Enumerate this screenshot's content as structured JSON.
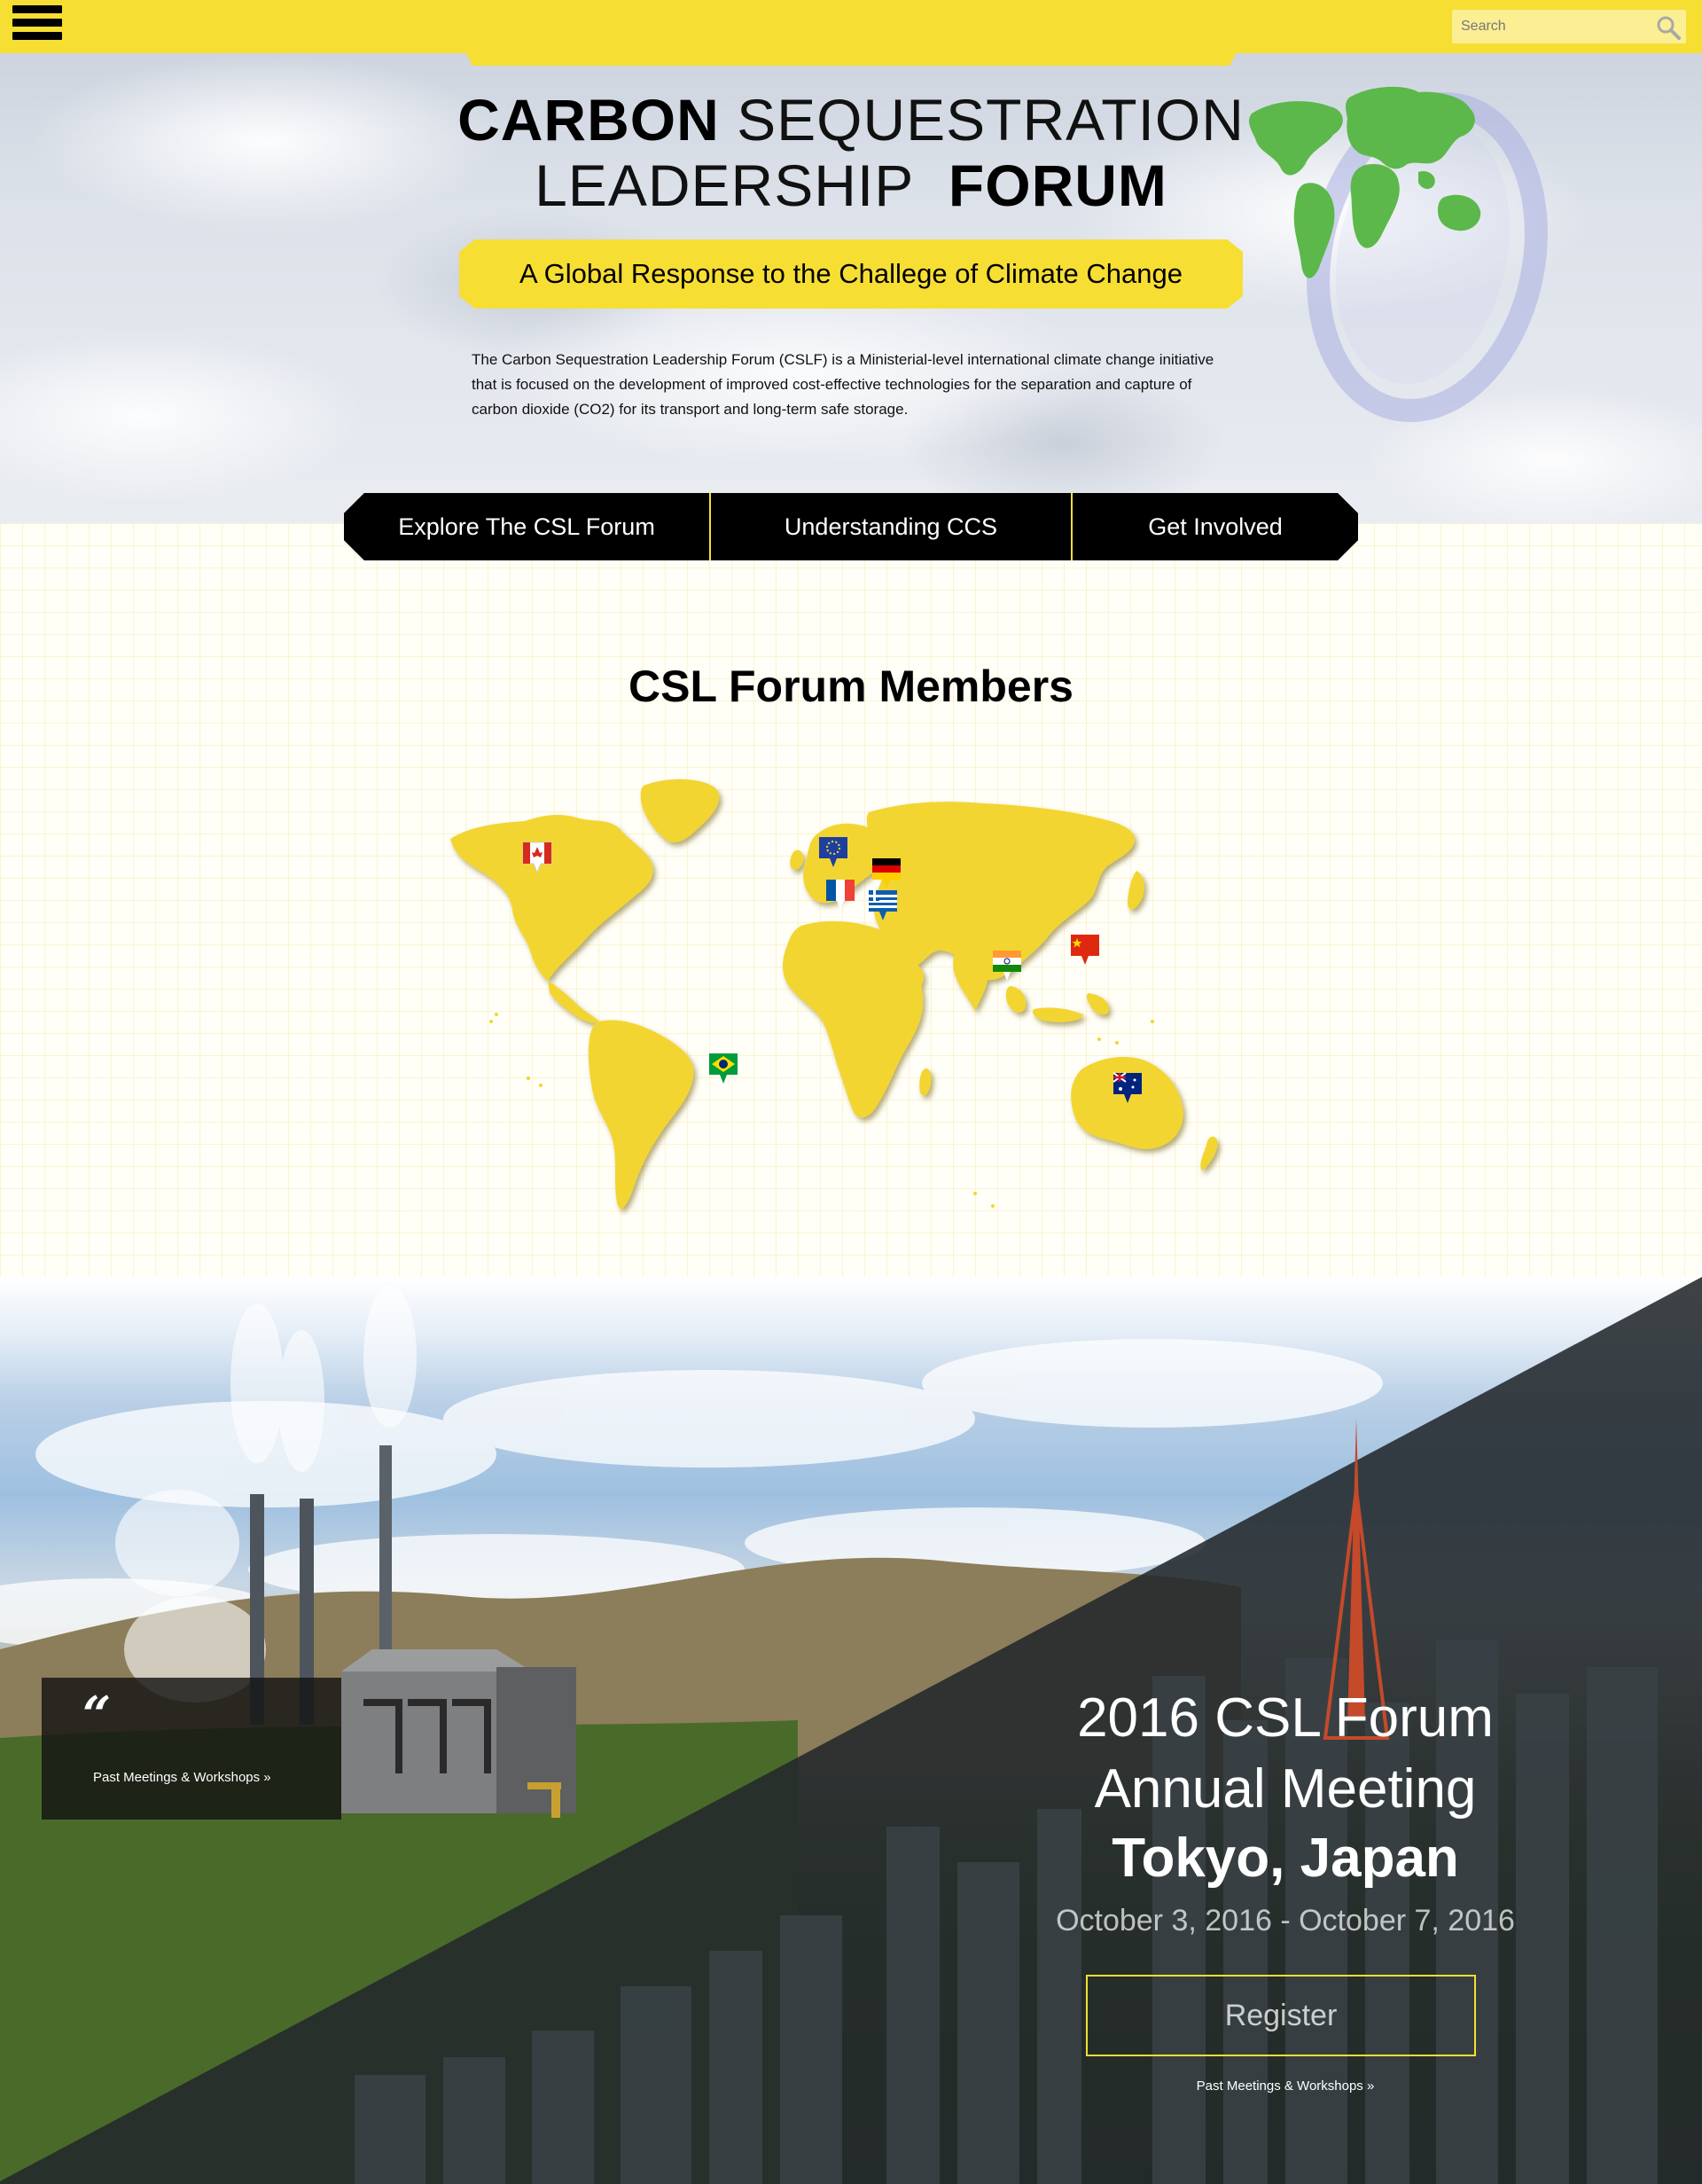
{
  "header": {
    "menu_icon": "hamburger-menu-icon",
    "search_placeholder": "Search",
    "search_icon": "search-icon",
    "accent_color": "#f7de33"
  },
  "hero": {
    "title_line1_bold": "CARBON",
    "title_line1_light": "SEQUESTRATION",
    "title_line2_light": "LEADERSHIP",
    "title_line2_bold": "FORUM",
    "tagline": "A Global Response to the Challege of Climate Change",
    "intro": "The Carbon Sequestration Leadership Forum (CSLF) is a Ministerial-level international climate change initiative that is focused on the development of improved cost-effective technologies for the separation and capture of carbon dioxide (CO2) for its transport and long-term safe storage.",
    "globe_icon": "globe-icon"
  },
  "nav": {
    "items": [
      {
        "label": "Explore The CSL Forum"
      },
      {
        "label": "Understanding CCS"
      },
      {
        "label": "Get Involved"
      }
    ]
  },
  "members": {
    "title": "CSL Forum Members",
    "flags": [
      "canada-flag-icon",
      "eu-flag-icon",
      "germany-flag-icon",
      "france-flag-icon",
      "greece-flag-icon",
      "china-flag-icon",
      "india-flag-icon",
      "brazil-flag-icon",
      "australia-flag-icon"
    ]
  },
  "meeting": {
    "quote_mark": "“",
    "quote_link": "Past Meetings & Workshops »",
    "heading_line1": "2016 CSL Forum",
    "heading_line2": "Annual Meeting",
    "city": "Tokyo, Japan",
    "dates": "October 3, 2016 - October 7, 2016",
    "register_label": "Register",
    "past_link": "Past Meetings & Workshops »"
  }
}
